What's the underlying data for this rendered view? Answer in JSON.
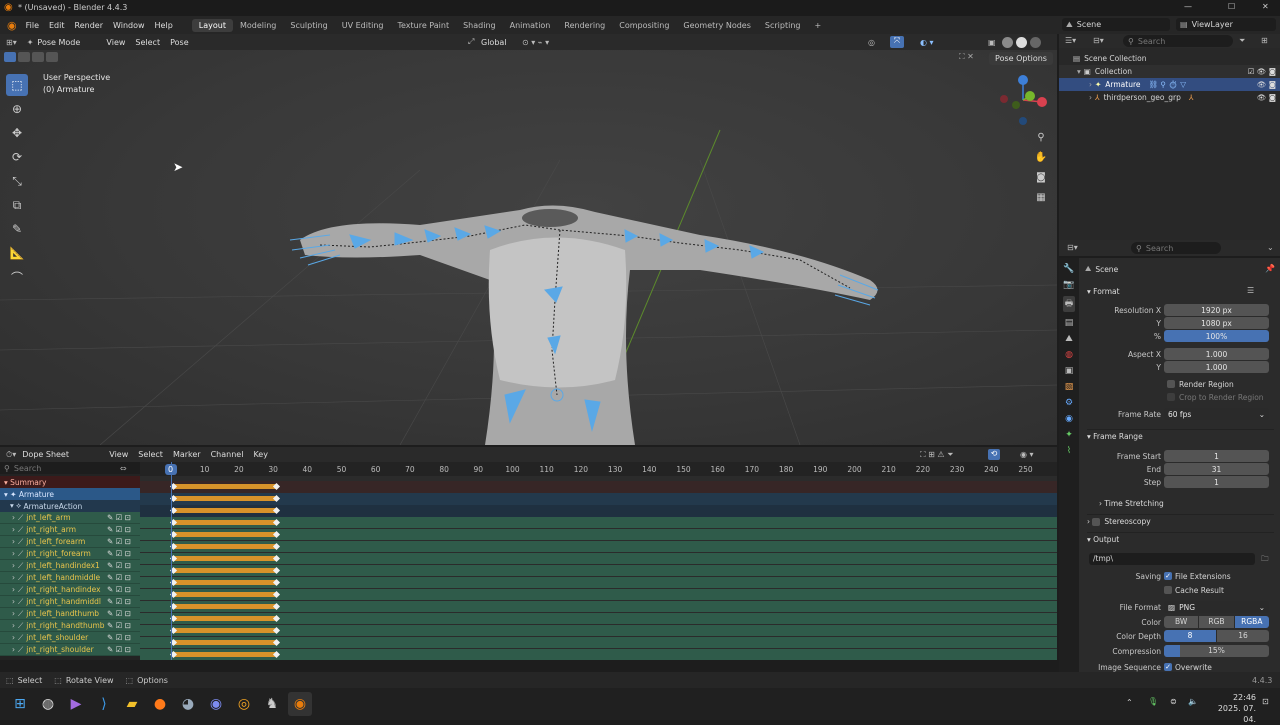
{
  "window": {
    "title": "* (Unsaved) - Blender 4.4.3",
    "min": "—",
    "max": "☐",
    "close": "✕"
  },
  "menu": [
    "File",
    "Edit",
    "Render",
    "Window",
    "Help"
  ],
  "workspaces": [
    "Layout",
    "Modeling",
    "Sculpting",
    "UV Editing",
    "Texture Paint",
    "Shading",
    "Animation",
    "Rendering",
    "Compositing",
    "Geometry Nodes",
    "Scripting"
  ],
  "workspace_add": "+",
  "scene_selector": {
    "scene": "Scene",
    "view_layer": "ViewLayer"
  },
  "viewport_header": {
    "mode": "Pose Mode",
    "menus": [
      "View",
      "Select",
      "Pose"
    ],
    "transform_orientation": "Global",
    "pose_options": "Pose Options"
  },
  "viewport": {
    "perspective": "User Perspective",
    "object": "(0) Armature"
  },
  "gizmo": {
    "x": "X",
    "y": "Y",
    "z": "Z"
  },
  "dope_header": {
    "editor": "Dope Sheet",
    "menus": [
      "View",
      "Select",
      "Marker",
      "Channel",
      "Key"
    ]
  },
  "dope": {
    "search_placeholder": "Search",
    "current_frame": "0",
    "ticks": [
      "0",
      "10",
      "20",
      "30",
      "40",
      "50",
      "60",
      "70",
      "80",
      "90",
      "100",
      "110",
      "120",
      "130",
      "140",
      "150",
      "160",
      "170",
      "180",
      "190",
      "200",
      "210",
      "220",
      "230",
      "240",
      "250"
    ],
    "summary": "Summary",
    "armature": "Armature",
    "action": "ArmatureAction",
    "key_start": 1,
    "key_end": 31,
    "channels": [
      "jnt_left_arm",
      "jnt_right_arm",
      "jnt_left_forearm",
      "jnt_right_forearm",
      "jnt_left_handindex1",
      "jnt_left_handmiddle",
      "jnt_right_handindex",
      "jnt_right_handmiddl",
      "jnt_left_handthumb",
      "jnt_right_handthumb",
      "jnt_left_shoulder",
      "jnt_right_shoulder"
    ]
  },
  "statusbar": {
    "select": "Select",
    "rotate": "Rotate View",
    "options": "Options",
    "version": "4.4.3"
  },
  "outliner": {
    "search_placeholder": "Search",
    "scene_collection": "Scene Collection",
    "collection": "Collection",
    "items": [
      "Armature",
      "thirdperson_geo_grp"
    ]
  },
  "properties": {
    "search_placeholder": "Search",
    "context": "Scene",
    "format": "Format",
    "res_x_label": "Resolution X",
    "res_x": "1920 px",
    "res_y_label": "Y",
    "res_y": "1080 px",
    "res_pct_label": "%",
    "res_pct": "100%",
    "aspect_x_label": "Aspect X",
    "aspect_x": "1.000",
    "aspect_y_label": "Y",
    "aspect_y": "1.000",
    "render_region": "Render Region",
    "crop_region": "Crop to Render Region",
    "frame_rate_label": "Frame Rate",
    "frame_rate": "60 fps",
    "frame_range": "Frame Range",
    "frame_start_label": "Frame Start",
    "frame_start": "1",
    "end_label": "End",
    "end": "31",
    "step_label": "Step",
    "step": "1",
    "time_stretching": "Time Stretching",
    "stereoscopy": "Stereoscopy",
    "output": "Output",
    "output_path": "/tmp\\",
    "saving_label": "Saving",
    "file_extensions": "File Extensions",
    "cache_result": "Cache Result",
    "file_format_label": "File Format",
    "file_format": "PNG",
    "color_label": "Color",
    "color_opts": [
      "BW",
      "RGB",
      "RGBA"
    ],
    "color_depth_label": "Color Depth",
    "depth_opts": [
      "8",
      "16"
    ],
    "compression_label": "Compression",
    "compression": "15%",
    "compression_value": 0.15,
    "image_sequence_label": "Image Sequence",
    "overwrite": "Overwrite"
  },
  "taskbar": {
    "time": "22:46",
    "date": "2025. 07. 04."
  },
  "colors": {
    "accent": "#4772b3",
    "key_orange": "#d7922a",
    "bone_blue": "#5aa8e6",
    "channel_green": "#2f5b4a",
    "channel_text": "#e8c44c"
  }
}
